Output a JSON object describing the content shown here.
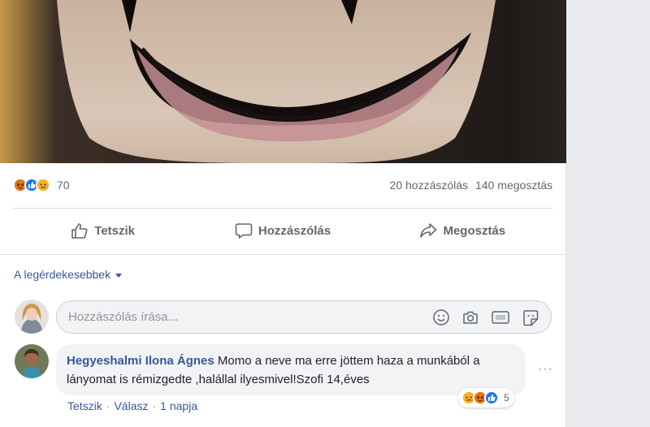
{
  "post": {
    "reactions": {
      "types": [
        "angry",
        "like",
        "sad"
      ],
      "count": "70"
    },
    "comment_count_text": "20 hozzászólás",
    "share_count_text": "140 megosztás"
  },
  "actions": {
    "like_label": "Tetszik",
    "comment_label": "Hozzászólás",
    "share_label": "Megosztás"
  },
  "sort": {
    "label": "A legérdekesebbek"
  },
  "composer": {
    "placeholder": "Hozzászólás írása...",
    "icons": [
      "emoji-icon",
      "camera-icon",
      "gif-icon",
      "sticker-icon"
    ]
  },
  "comments": [
    {
      "author": "Hegyeshalmi Ilona Ágnes",
      "text": "Momo a neve ma erre jöttem haza a munkából a lányomat is rémizgedte ,halállal ilyesmivel!Szofi 14,éves",
      "reactions": {
        "types": [
          "sad",
          "angry",
          "like"
        ],
        "count": "5"
      },
      "like_label": "Tetszik",
      "reply_label": "Válasz",
      "time": "1 napja",
      "separator": "·"
    }
  ],
  "colors": {
    "link": "#385898",
    "muted": "#606770",
    "like": "#1877f2",
    "angry": "#e9710f",
    "sad": "#f7b125"
  }
}
